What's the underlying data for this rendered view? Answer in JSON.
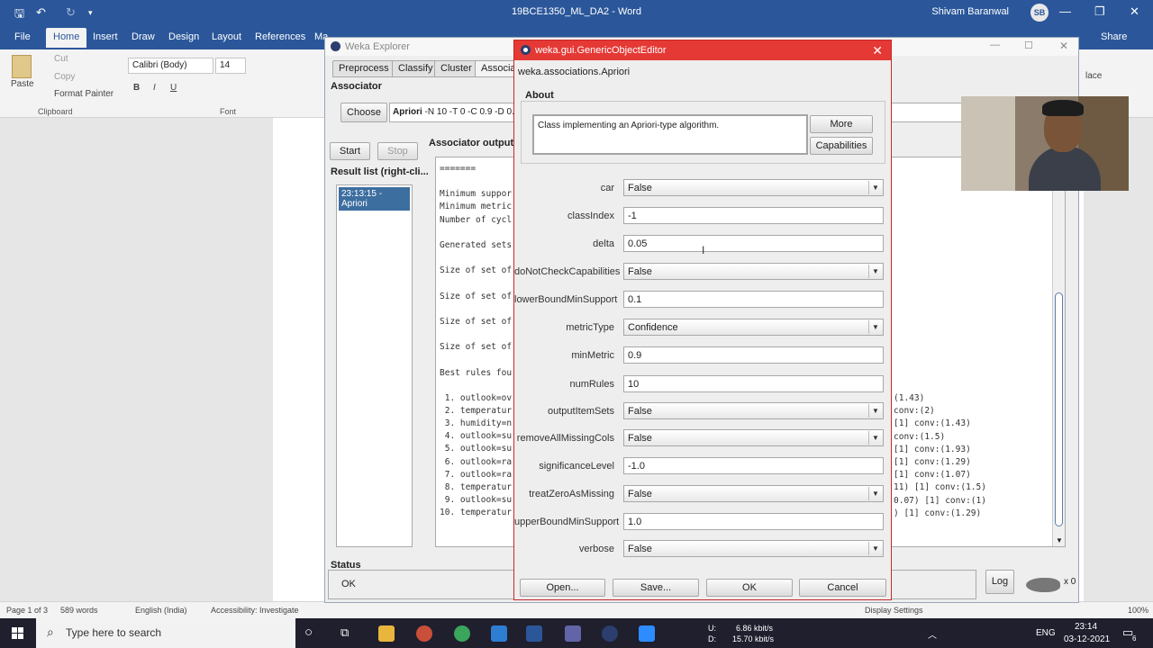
{
  "word": {
    "doc_title": "19BCE1350_ML_DA2 - Word",
    "user_name": "Shivam Baranwal",
    "user_initials": "SB",
    "share_label": "Share",
    "tabs": [
      "File",
      "Home",
      "Insert",
      "Draw",
      "Design",
      "Layout",
      "References",
      "Ma"
    ],
    "clipboard": {
      "paste": "Paste",
      "cut": "Cut",
      "copy": "Copy",
      "format_painter": "Format Painter",
      "group": "Clipboard"
    },
    "font": {
      "name": "Calibri (Body)",
      "size": "14",
      "group": "Font"
    },
    "ribbon_right": "lace",
    "status": {
      "page": "Page 1 of 3",
      "words": "589 words",
      "language": "English (India)",
      "accessibility": "Accessibility: Investigate",
      "display": "Display Settings",
      "zoom": "100%"
    }
  },
  "weka": {
    "title": "Weka Explorer",
    "tabs": [
      "Preprocess",
      "Classify",
      "Cluster",
      "Associat"
    ],
    "associator_label": "Associator",
    "choose_button": "Choose",
    "associator_cmd_bold": "Apriori",
    "associator_cmd": " -N 10 -T 0 -C 0.9 -D 0.0",
    "start_button": "Start",
    "stop_button": "Stop",
    "output_label": "Associator output",
    "result_list_label": "Result list (right-cli...",
    "result_item": "23:13:15 - Apriori",
    "output_left": [
      "=======",
      "",
      "Minimum suppor",
      "Minimum metric",
      "Number of cycl",
      "",
      "Generated sets",
      "",
      "Size of set of",
      "",
      "Size of set of",
      "",
      "Size of set of",
      "",
      "Size of set of",
      "",
      "Best rules fou",
      "",
      " 1. outlook=ov",
      " 2. temperatur",
      " 3. humidity=n",
      " 4. outlook=su",
      " 5. outlook=su",
      " 6. outlook=ra",
      " 7. outlook=ra",
      " 8. temperatur",
      " 9. outlook=su",
      "10. temperatur"
    ],
    "output_right": [
      "(1.43)",
      "conv:(2)",
      "[1] conv:(1.43)",
      "conv:(1.5)",
      "[1] conv:(1.93)",
      "[1] conv:(1.29)",
      "[1] conv:(1.07)",
      "11) [1] conv:(1.5)",
      "0.07) [1] conv:(1)",
      ") [1] conv:(1.29)"
    ],
    "status_label": "Status",
    "status_value": "OK",
    "log_button": "Log",
    "x_count": "x 0"
  },
  "dialog": {
    "title": "weka.gui.GenericObjectEditor",
    "class_name": "weka.associations.Apriori",
    "about_label": "About",
    "about_text": "Class implementing an Apriori-type algorithm.",
    "more_button": "More",
    "capabilities_button": "Capabilities",
    "properties": [
      {
        "label": "car",
        "value": "False",
        "type": "combo"
      },
      {
        "label": "classIndex",
        "value": "-1",
        "type": "text"
      },
      {
        "label": "delta",
        "value": "0.05",
        "type": "text"
      },
      {
        "label": "doNotCheckCapabilities",
        "value": "False",
        "type": "combo"
      },
      {
        "label": "lowerBoundMinSupport",
        "value": "0.1",
        "type": "text"
      },
      {
        "label": "metricType",
        "value": "Confidence",
        "type": "combo"
      },
      {
        "label": "minMetric",
        "value": "0.9",
        "type": "text"
      },
      {
        "label": "numRules",
        "value": "10",
        "type": "text"
      },
      {
        "label": "outputItemSets",
        "value": "False",
        "type": "combo"
      },
      {
        "label": "removeAllMissingCols",
        "value": "False",
        "type": "combo"
      },
      {
        "label": "significanceLevel",
        "value": "-1.0",
        "type": "text"
      },
      {
        "label": "treatZeroAsMissing",
        "value": "False",
        "type": "combo"
      },
      {
        "label": "upperBoundMinSupport",
        "value": "1.0",
        "type": "text"
      },
      {
        "label": "verbose",
        "value": "False",
        "type": "combo"
      }
    ],
    "open_button": "Open...",
    "save_button": "Save...",
    "ok_button": "OK",
    "cancel_button": "Cancel"
  },
  "taskbar": {
    "search_placeholder": "Type here to search",
    "net_up_label": "U:",
    "net_up": "6.86 kbit/s",
    "net_down_label": "D:",
    "net_down": "15.70 kbit/s",
    "lang": "ENG",
    "time": "23:14",
    "date": "03-12-2021",
    "notif_count": "6"
  }
}
